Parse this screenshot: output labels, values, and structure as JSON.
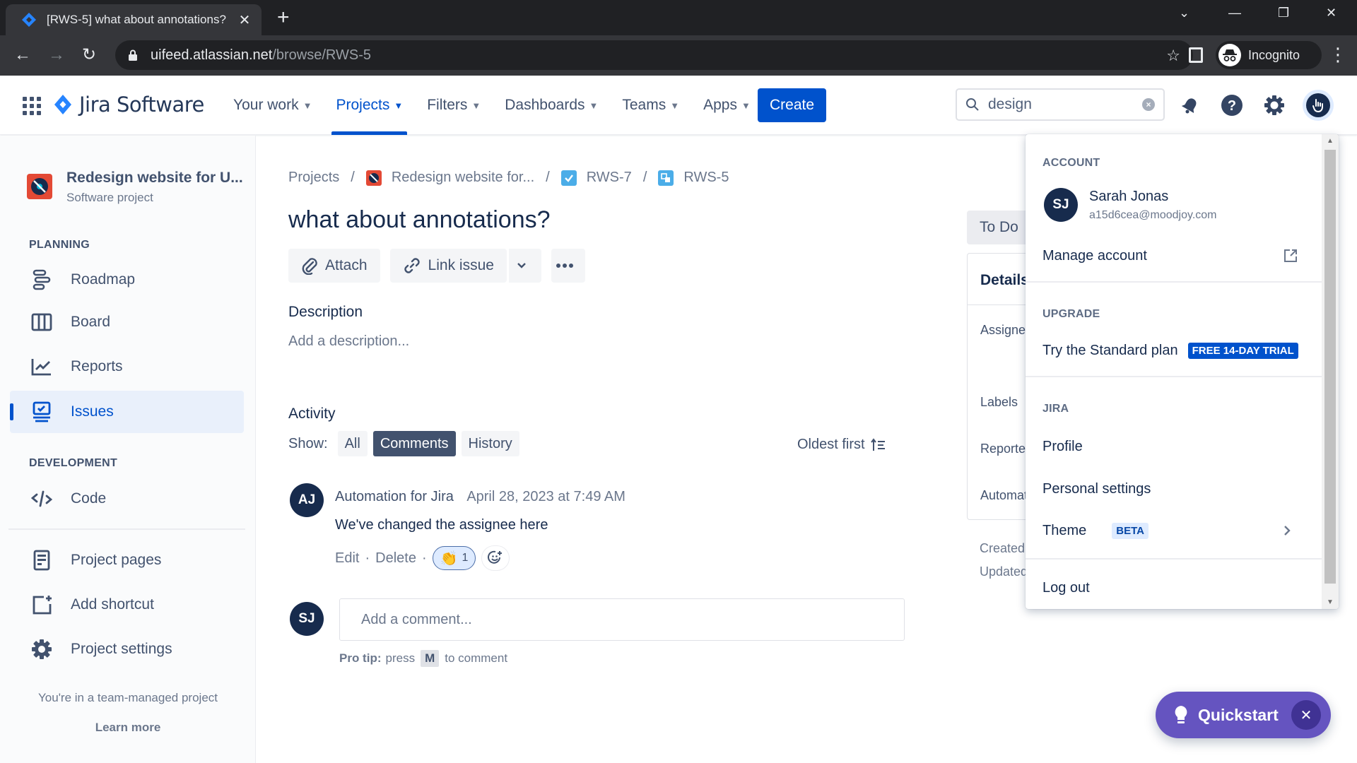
{
  "browser": {
    "tab_title": "[RWS-5] what about annotations?",
    "url_host": "uifeed.atlassian.net",
    "url_path": "/browse/RWS-5",
    "profile_label": "Incognito"
  },
  "topnav": {
    "product": "Jira Software",
    "items": [
      {
        "label": "Your work",
        "active": false
      },
      {
        "label": "Projects",
        "active": true
      },
      {
        "label": "Filters",
        "active": false
      },
      {
        "label": "Dashboards",
        "active": false
      },
      {
        "label": "Teams",
        "active": false
      },
      {
        "label": "Apps",
        "active": false
      }
    ],
    "create_label": "Create",
    "search_value": "design",
    "accent": "#0052cc"
  },
  "sidebar": {
    "project_name": "Redesign website for U...",
    "project_type": "Software project",
    "planning_title": "PLANNING",
    "planning": [
      {
        "label": "Roadmap",
        "icon": "roadmap-icon"
      },
      {
        "label": "Board",
        "icon": "board-icon"
      },
      {
        "label": "Reports",
        "icon": "reports-icon"
      },
      {
        "label": "Issues",
        "icon": "issues-icon",
        "active": true
      }
    ],
    "development_title": "DEVELOPMENT",
    "development": [
      {
        "label": "Code",
        "icon": "code-icon"
      }
    ],
    "extra": [
      {
        "label": "Project pages",
        "icon": "page-icon"
      },
      {
        "label": "Add shortcut",
        "icon": "add-shortcut-icon"
      },
      {
        "label": "Project settings",
        "icon": "gear-icon"
      }
    ],
    "footer_text": "You're in a team-managed project",
    "footer_link": "Learn more"
  },
  "issue": {
    "breadcrumb": [
      "Projects",
      "Redesign website for...",
      "RWS-7",
      "RWS-5"
    ],
    "title": "what about annotations?",
    "actions": {
      "attach": "Attach",
      "link": "Link issue"
    },
    "description_label": "Description",
    "description_placeholder": "Add a description...",
    "activity_label": "Activity",
    "show_label": "Show:",
    "filters": [
      {
        "label": "All",
        "active": false
      },
      {
        "label": "Comments",
        "active": true
      },
      {
        "label": "History",
        "active": false
      }
    ],
    "sort_label": "Oldest first",
    "comments": [
      {
        "initials": "AJ",
        "author": "Automation for Jira",
        "time": "April 28, 2023 at 7:49 AM",
        "body": "We've changed the assignee here",
        "edit": "Edit",
        "delete": "Delete",
        "reaction_emoji": "👏",
        "reaction_count": "1"
      }
    ],
    "new_comment": {
      "initials": "SJ",
      "placeholder": "Add a comment...",
      "protip_bold": "Pro tip:",
      "protip_pre": "press",
      "protip_key": "M",
      "protip_post": "to comment"
    }
  },
  "panel": {
    "status": "To Do",
    "details_title": "Details",
    "fields": [
      "Assignee",
      "Labels",
      "Reporter",
      "Automation"
    ],
    "created": "Created",
    "updated": "Updated"
  },
  "account_menu": {
    "account_title": "ACCOUNT",
    "user_initials": "SJ",
    "user_name": "Sarah Jonas",
    "user_email": "a15d6cea@moodjoy.com",
    "manage_account": "Manage account",
    "upgrade_title": "UPGRADE",
    "upgrade_item": "Try the Standard plan",
    "upgrade_badge": "FREE 14-DAY TRIAL",
    "jira_title": "JIRA",
    "profile": "Profile",
    "personal_settings": "Personal settings",
    "theme": "Theme",
    "theme_badge": "BETA",
    "logout": "Log out"
  },
  "quickstart": {
    "label": "Quickstart",
    "color": "#6554c0"
  }
}
